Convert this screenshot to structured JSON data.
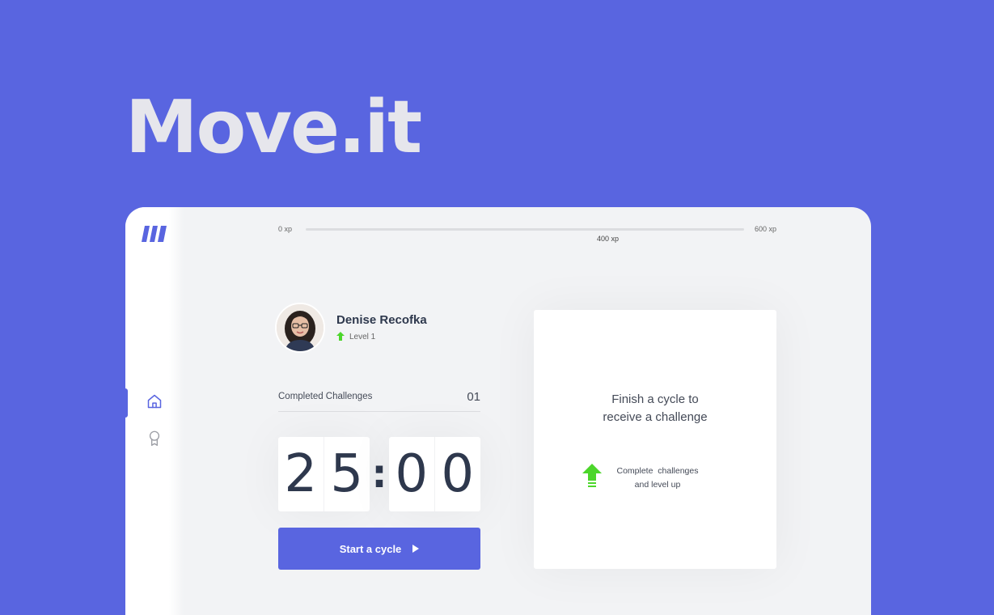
{
  "hero": {
    "title": "Move.it"
  },
  "xp_bar": {
    "min_label": "0 xp",
    "max_label": "600 xp",
    "current_label": "400 xp",
    "progress": 0
  },
  "sidebar": {
    "items": [
      {
        "name": "home",
        "icon": "home-icon",
        "active": true
      },
      {
        "name": "award",
        "icon": "award-icon",
        "active": false
      }
    ]
  },
  "profile": {
    "name": "Denise Recofka",
    "level_label": "Level 1"
  },
  "challenges": {
    "label": "Completed Challenges",
    "count": "01"
  },
  "countdown": {
    "minute_left": "2",
    "minute_right": "5",
    "separator": ":",
    "second_left": "0",
    "second_right": "0"
  },
  "actions": {
    "start_label": "Start a cycle"
  },
  "challenge_box": {
    "title_line1": "Finish a cycle to",
    "title_line2": "receive a challenge",
    "hint_line1": "Complete  challenges",
    "hint_line2": "and level up"
  },
  "colors": {
    "background": "#5965e0",
    "accent": "#5965e0",
    "level_up": "#4cd62b",
    "text_dark": "#2e384d"
  }
}
